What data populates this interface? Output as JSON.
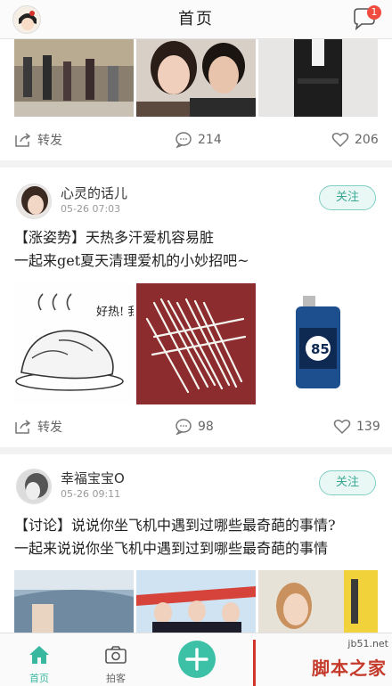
{
  "header": {
    "title": "首页",
    "badge": "1",
    "avatar_icon": "user-avatar",
    "msg_icon": "chat-bubble-icon"
  },
  "post0": {
    "repost": "转发",
    "comments": "214",
    "likes": "206"
  },
  "post1": {
    "name": "心灵的话儿",
    "time": "05-26 07:03",
    "follow": "关注",
    "line1": "【涨姿势】天热多汗爱机容易脏",
    "line2": "一起来get夏天清理爱机的小妙招吧~",
    "img1_caption": "好热! 我快!",
    "img3_caption": "85",
    "repost": "转发",
    "comments": "98",
    "likes": "139"
  },
  "post2": {
    "name": "幸福宝宝O",
    "time": "05-26 09:11",
    "follow": "关注",
    "line1": "【讨论】说说你坐飞机中遇到过哪些最奇葩的事情?",
    "line2": "一起来说说你坐飞机中遇到过到哪些最奇葩的事情"
  },
  "tabbar": {
    "home": "首页",
    "photo": "拍客",
    "add_icon": "plus-icon"
  },
  "watermark": {
    "url": "jb51.net",
    "text": "脚本之家"
  },
  "colors": {
    "accent": "#3cc1a7",
    "badge": "#ef4b3f"
  }
}
